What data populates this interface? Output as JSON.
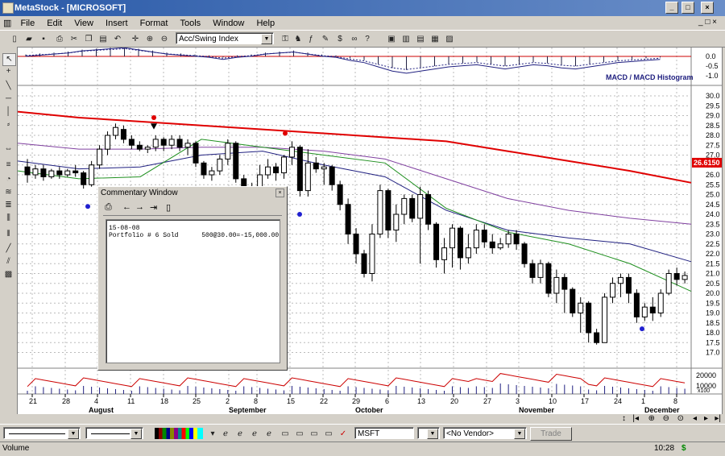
{
  "window": {
    "title": "MetaStock - [MICROSOFT]",
    "min": "_",
    "max": "□",
    "close": "×"
  },
  "menu": [
    "File",
    "Edit",
    "View",
    "Insert",
    "Format",
    "Tools",
    "Window",
    "Help"
  ],
  "toolbar": {
    "indicator_select": "Acc/Swing Index"
  },
  "indicator_panel": {
    "label": "MACD / MACD Histogram",
    "ticks": [
      "0.0",
      "-0.5",
      "-1.0"
    ]
  },
  "price_panel": {
    "ticks": [
      "30.0",
      "29.5",
      "29.0",
      "28.5",
      "28.0",
      "27.5",
      "27.0",
      "26.5",
      "26.0",
      "25.5",
      "25.0",
      "24.5",
      "24.0",
      "23.5",
      "23.0",
      "22.5",
      "22.0",
      "21.5",
      "21.0",
      "20.5",
      "20.0",
      "19.5",
      "19.0",
      "18.5",
      "18.0",
      "17.5",
      "17.0"
    ],
    "last_price_label": "26.6150"
  },
  "volume_panel": {
    "ticks": [
      "20000",
      "10000"
    ],
    "unit": "x100"
  },
  "xaxis": {
    "days": [
      "21",
      "28",
      "4",
      "11",
      "18",
      "25",
      "2",
      "8",
      "15",
      "22",
      "29",
      "6",
      "13",
      "20",
      "27",
      "3",
      "10",
      "17",
      "24",
      "1",
      "8"
    ],
    "months": [
      "August",
      "September",
      "October",
      "November",
      "December"
    ]
  },
  "commentary": {
    "title": "Commentary Window",
    "line1": "15-08-08",
    "line2": "Portfolio # 6 Sold      500@30.00=-15,000.00"
  },
  "bottombar": {
    "symbol": "MSFT",
    "vendor": "<No Vendor>",
    "trade": "Trade"
  },
  "status": {
    "left": "Volume",
    "time": "10:28",
    "icon": "$"
  },
  "colors": {
    "ma_red": "#e00000",
    "ma_purple": "#8040a0",
    "ma_navy": "#202080",
    "ma_green": "#209020",
    "title_bar": "#2a5aa8"
  },
  "chart_data": {
    "type": "candlestick",
    "moving_average_red": [
      29.2,
      28.9,
      28.7,
      28.5,
      28.3,
      28.1,
      27.9,
      27.7,
      27.2,
      26.7,
      26.2,
      25.6
    ],
    "moving_average_purple": [
      27.6,
      27.3,
      27.3,
      27.4,
      27.4,
      27.2,
      26.8,
      25.8,
      24.8,
      24.2,
      23.8,
      23.5
    ],
    "moving_average_navy": [
      26.7,
      26.3,
      26.4,
      27.0,
      27.2,
      26.5,
      25.9,
      24.2,
      23.2,
      22.8,
      22.5,
      21.6
    ],
    "moving_average_green": [
      26.2,
      25.8,
      25.9,
      27.8,
      27.4,
      27.0,
      26.6,
      24.3,
      23.1,
      22.5,
      21.5,
      20.1
    ]
  }
}
